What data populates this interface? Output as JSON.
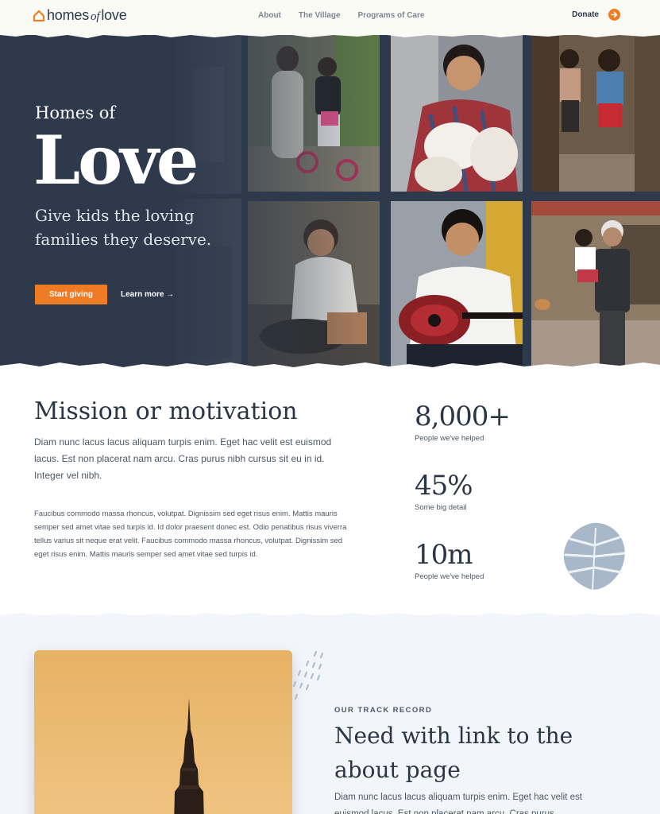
{
  "nav": {
    "logo": {
      "part1": "homes",
      "part2": "of",
      "part3": "love"
    },
    "links": [
      "About",
      "The Village",
      "Programs of Care"
    ],
    "donate_label": "Donate"
  },
  "hero": {
    "kicker": "Homes of",
    "big_word": "Love",
    "subtitle": "Give kids the loving families they deserve.",
    "primary_button": "Start giving",
    "secondary_link": "Learn more",
    "secondary_arrow": "→"
  },
  "mission": {
    "title": "Mission or motivation",
    "lead": "Diam nunc lacus lacus aliquam turpis enim. Eget hac velit est euismod lacus. Est non placerat nam arcu. Cras purus nibh cursus sit eu in id. Integer vel nibh.",
    "body": "Faucibus commodo massa rhoncus, volutpat. Dignissim sed eget risus enim. Mattis mauris semper sed amet vitae sed turpis id. Id dolor praesent donec est. Odio penatibus risus viverra tellus varius sit neque erat velit. Faucibus commodo massa rhoncus, volutpat. Dignissim sed eget risus enim. Mattis mauris semper sed amet vitae sed turpis id."
  },
  "stats": [
    {
      "value": "8,000+",
      "label": "People we've helped"
    },
    {
      "value": "45%",
      "label": "Some big detail"
    },
    {
      "value": "10m",
      "label": "People we've helped"
    }
  ],
  "track": {
    "kicker": "OUR TRACK RECORD",
    "title": "Need with link to the about page",
    "text": "Diam nunc lacus lacus aliquam turpis enim. Eget hac velit est euismod lacus. Est non placerat nam arcu. Cras purus"
  },
  "icons": {
    "logo": "house-icon",
    "donate": "arrow-right-circle-icon",
    "decor": "monstera-leaf-icon"
  },
  "colors": {
    "accent": "#f07b25",
    "hero_bg": "#2e3a4c",
    "text": "#2b3645",
    "track_bg": "#f2f5f9",
    "leaf": "#a9b8c9"
  }
}
